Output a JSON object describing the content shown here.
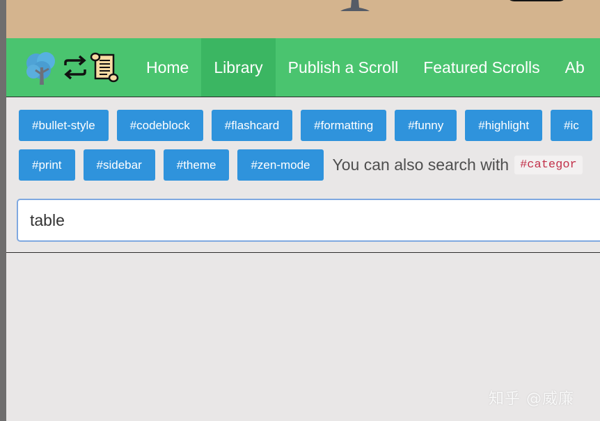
{
  "nav": {
    "items": [
      {
        "label": "Home"
      },
      {
        "label": "Library"
      },
      {
        "label": "Publish a Scroll"
      },
      {
        "label": "Featured Scrolls"
      },
      {
        "label": "Ab"
      }
    ],
    "active_index": 1,
    "colors": {
      "background": "#4ac46f",
      "active": "#3bb662"
    }
  },
  "tags": {
    "row1": [
      "#bullet-style",
      "#codeblock",
      "#flashcard",
      "#formatting",
      "#funny",
      "#highlight",
      "#ic"
    ],
    "row2": [
      "#print",
      "#sidebar",
      "#theme",
      "#zen-mode"
    ],
    "color": "#2f93dc"
  },
  "hint": {
    "text": "You can also search with",
    "code": "#categor"
  },
  "search": {
    "value": "table"
  },
  "watermark": "知乎 @威廉",
  "banner_color": "#d4b48e"
}
